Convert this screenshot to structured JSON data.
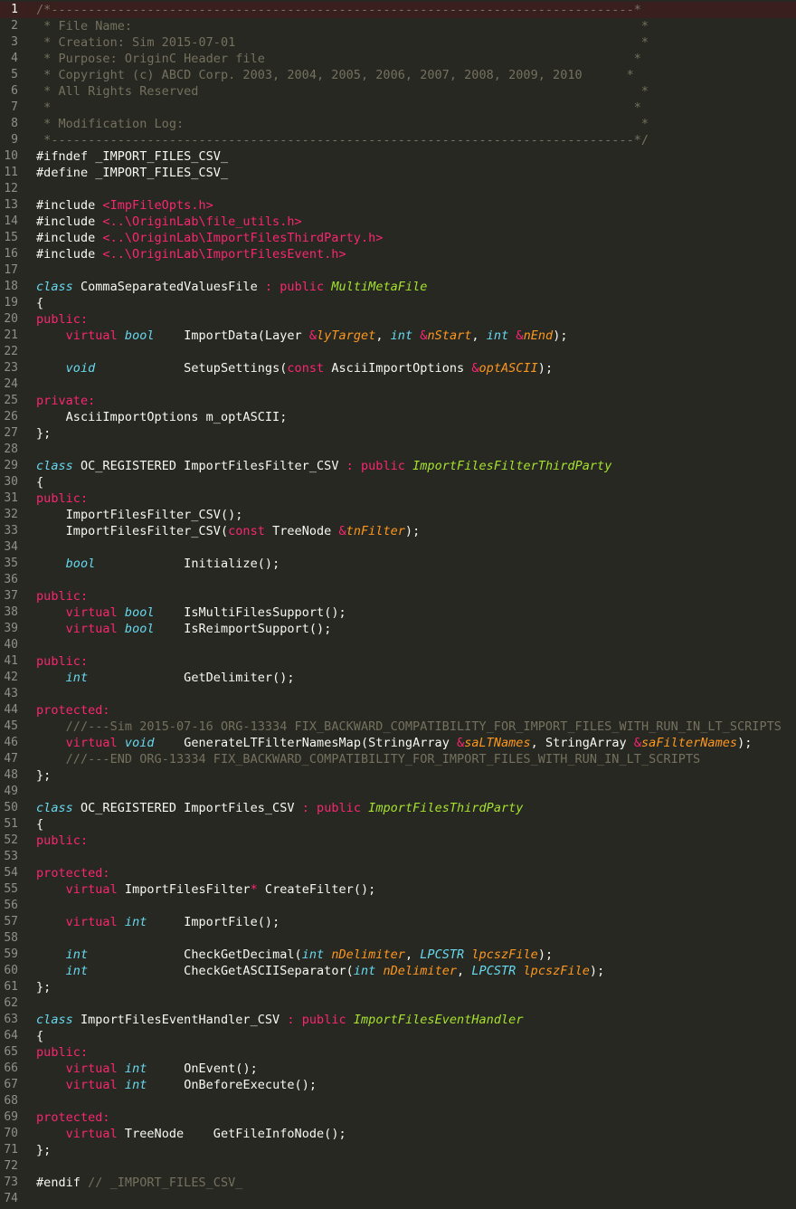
{
  "editor": {
    "theme_colors": {
      "background": "#272822",
      "current_line": "#3a1f1f",
      "comment": "#75715e",
      "keyword": "#f92672",
      "type": "#66d9ef",
      "inherit": "#a6e22e",
      "param": "#fd971f",
      "string": "#e6db74",
      "text": "#f8f8f2",
      "gutter_text": "#8f908a"
    },
    "current_line": 1,
    "lines": [
      {
        "n": "1",
        "tokens": [
          [
            "t-comment",
            "/*-------------------------------------------------------------------------------*"
          ]
        ]
      },
      {
        "n": "2",
        "tokens": [
          [
            "t-comment",
            " * File Name:                                                                     *"
          ]
        ]
      },
      {
        "n": "3",
        "tokens": [
          [
            "t-comment",
            " * Creation: Sim 2015-07-01                                                       *"
          ]
        ]
      },
      {
        "n": "4",
        "tokens": [
          [
            "t-comment",
            " * Purpose: OriginC Header file                                                  *"
          ]
        ]
      },
      {
        "n": "5",
        "tokens": [
          [
            "t-comment",
            " * Copyright (c) ABCD Corp. 2003, 2004, 2005, 2006, 2007, 2008, 2009, 2010      *"
          ]
        ]
      },
      {
        "n": "6",
        "tokens": [
          [
            "t-comment",
            " * All Rights Reserved                                                            *"
          ]
        ]
      },
      {
        "n": "7",
        "tokens": [
          [
            "t-comment",
            " *                                                                               *"
          ]
        ]
      },
      {
        "n": "8",
        "tokens": [
          [
            "t-comment",
            " * Modification Log:                                                              *"
          ]
        ]
      },
      {
        "n": "9",
        "tokens": [
          [
            "t-comment",
            " *-------------------------------------------------------------------------------*/"
          ]
        ]
      },
      {
        "n": "10",
        "tokens": [
          [
            "t-pp",
            "#ifndef _IMPORT_FILES_CSV_"
          ]
        ]
      },
      {
        "n": "11",
        "tokens": [
          [
            "t-pp",
            "#define _IMPORT_FILES_CSV_"
          ]
        ]
      },
      {
        "n": "12",
        "tokens": []
      },
      {
        "n": "13",
        "tokens": [
          [
            "t-pp",
            "#include "
          ],
          [
            "t-kw",
            "<ImpFileOpts.h>"
          ]
        ]
      },
      {
        "n": "14",
        "tokens": [
          [
            "t-pp",
            "#include "
          ],
          [
            "t-kw",
            "<..\\OriginLab\\file_utils.h>"
          ]
        ]
      },
      {
        "n": "15",
        "tokens": [
          [
            "t-pp",
            "#include "
          ],
          [
            "t-kw",
            "<..\\OriginLab\\ImportFilesThirdParty.h>"
          ]
        ]
      },
      {
        "n": "16",
        "tokens": [
          [
            "t-pp",
            "#include "
          ],
          [
            "t-kw",
            "<..\\OriginLab\\ImportFilesEvent.h>"
          ]
        ]
      },
      {
        "n": "17",
        "tokens": []
      },
      {
        "n": "18",
        "tokens": [
          [
            "t-storage",
            "class"
          ],
          [
            "t-text",
            " CommaSeparatedValuesFile "
          ],
          [
            "t-op",
            ":"
          ],
          [
            "t-text",
            " "
          ],
          [
            "t-access",
            "public"
          ],
          [
            "t-text",
            " "
          ],
          [
            "t-inherit",
            "MultiMetaFile"
          ]
        ]
      },
      {
        "n": "19",
        "tokens": [
          [
            "t-text",
            "{"
          ]
        ]
      },
      {
        "n": "20",
        "tokens": [
          [
            "t-access",
            "public"
          ],
          [
            "t-op",
            ":"
          ]
        ]
      },
      {
        "n": "21",
        "tokens": [
          [
            "t-text",
            "    "
          ],
          [
            "t-mod",
            "virtual"
          ],
          [
            "t-text",
            " "
          ],
          [
            "t-type",
            "bool"
          ],
          [
            "t-text",
            "    ImportData(Layer "
          ],
          [
            "t-op",
            "&"
          ],
          [
            "t-param",
            "lyTarget"
          ],
          [
            "t-text",
            ", "
          ],
          [
            "t-type",
            "int"
          ],
          [
            "t-text",
            " "
          ],
          [
            "t-op",
            "&"
          ],
          [
            "t-param",
            "nStart"
          ],
          [
            "t-text",
            ", "
          ],
          [
            "t-type",
            "int"
          ],
          [
            "t-text",
            " "
          ],
          [
            "t-op",
            "&"
          ],
          [
            "t-param",
            "nEnd"
          ],
          [
            "t-text",
            ");"
          ]
        ]
      },
      {
        "n": "22",
        "tokens": []
      },
      {
        "n": "23",
        "tokens": [
          [
            "t-text",
            "    "
          ],
          [
            "t-type",
            "void"
          ],
          [
            "t-text",
            "            SetupSettings("
          ],
          [
            "t-mod",
            "const"
          ],
          [
            "t-text",
            " AsciiImportOptions "
          ],
          [
            "t-op",
            "&"
          ],
          [
            "t-param",
            "optASCII"
          ],
          [
            "t-text",
            ");"
          ]
        ]
      },
      {
        "n": "24",
        "tokens": []
      },
      {
        "n": "25",
        "tokens": [
          [
            "t-access",
            "private"
          ],
          [
            "t-op",
            ":"
          ]
        ]
      },
      {
        "n": "26",
        "tokens": [
          [
            "t-text",
            "    AsciiImportOptions m_optASCII;"
          ]
        ]
      },
      {
        "n": "27",
        "tokens": [
          [
            "t-text",
            "};"
          ]
        ]
      },
      {
        "n": "28",
        "tokens": []
      },
      {
        "n": "29",
        "tokens": [
          [
            "t-storage",
            "class"
          ],
          [
            "t-text",
            " OC_REGISTERED ImportFilesFilter_CSV "
          ],
          [
            "t-op",
            ":"
          ],
          [
            "t-text",
            " "
          ],
          [
            "t-access",
            "public"
          ],
          [
            "t-text",
            " "
          ],
          [
            "t-inherit",
            "ImportFilesFilterThirdParty"
          ]
        ]
      },
      {
        "n": "30",
        "tokens": [
          [
            "t-text",
            "{"
          ]
        ]
      },
      {
        "n": "31",
        "tokens": [
          [
            "t-access",
            "public"
          ],
          [
            "t-op",
            ":"
          ]
        ]
      },
      {
        "n": "32",
        "tokens": [
          [
            "t-text",
            "    ImportFilesFilter_CSV();"
          ]
        ]
      },
      {
        "n": "33",
        "tokens": [
          [
            "t-text",
            "    ImportFilesFilter_CSV("
          ],
          [
            "t-mod",
            "const"
          ],
          [
            "t-text",
            " TreeNode "
          ],
          [
            "t-op",
            "&"
          ],
          [
            "t-param",
            "tnFilter"
          ],
          [
            "t-text",
            ");"
          ]
        ]
      },
      {
        "n": "34",
        "tokens": []
      },
      {
        "n": "35",
        "tokens": [
          [
            "t-text",
            "    "
          ],
          [
            "t-type",
            "bool"
          ],
          [
            "t-text",
            "            Initialize();"
          ]
        ]
      },
      {
        "n": "36",
        "tokens": []
      },
      {
        "n": "37",
        "tokens": [
          [
            "t-access",
            "public"
          ],
          [
            "t-op",
            ":"
          ]
        ]
      },
      {
        "n": "38",
        "tokens": [
          [
            "t-text",
            "    "
          ],
          [
            "t-mod",
            "virtual"
          ],
          [
            "t-text",
            " "
          ],
          [
            "t-type",
            "bool"
          ],
          [
            "t-text",
            "    IsMultiFilesSupport();"
          ]
        ]
      },
      {
        "n": "39",
        "tokens": [
          [
            "t-text",
            "    "
          ],
          [
            "t-mod",
            "virtual"
          ],
          [
            "t-text",
            " "
          ],
          [
            "t-type",
            "bool"
          ],
          [
            "t-text",
            "    IsReimportSupport();"
          ]
        ]
      },
      {
        "n": "40",
        "tokens": []
      },
      {
        "n": "41",
        "tokens": [
          [
            "t-access",
            "public"
          ],
          [
            "t-op",
            ":"
          ]
        ]
      },
      {
        "n": "42",
        "tokens": [
          [
            "t-text",
            "    "
          ],
          [
            "t-type",
            "int"
          ],
          [
            "t-text",
            "             GetDelimiter();"
          ]
        ]
      },
      {
        "n": "43",
        "tokens": []
      },
      {
        "n": "44",
        "tokens": [
          [
            "t-access",
            "protected"
          ],
          [
            "t-op",
            ":"
          ]
        ]
      },
      {
        "n": "45",
        "tokens": [
          [
            "t-text",
            "    "
          ],
          [
            "t-comment",
            "///---Sim 2015-07-16 ORG-13334 FIX_BACKWARD_COMPATIBILITY_FOR_IMPORT_FILES_WITH_RUN_IN_LT_SCRIPTS"
          ]
        ]
      },
      {
        "n": "46",
        "tokens": [
          [
            "t-text",
            "    "
          ],
          [
            "t-mod",
            "virtual"
          ],
          [
            "t-text",
            " "
          ],
          [
            "t-type",
            "void"
          ],
          [
            "t-text",
            "    GenerateLTFilterNamesMap(StringArray "
          ],
          [
            "t-op",
            "&"
          ],
          [
            "t-param",
            "saLTNames"
          ],
          [
            "t-text",
            ", StringArray "
          ],
          [
            "t-op",
            "&"
          ],
          [
            "t-param",
            "saFilterNames"
          ],
          [
            "t-text",
            ");"
          ]
        ]
      },
      {
        "n": "47",
        "tokens": [
          [
            "t-text",
            "    "
          ],
          [
            "t-comment",
            "///---END ORG-13334 FIX_BACKWARD_COMPATIBILITY_FOR_IMPORT_FILES_WITH_RUN_IN_LT_SCRIPTS"
          ]
        ]
      },
      {
        "n": "48",
        "tokens": [
          [
            "t-text",
            "};"
          ]
        ]
      },
      {
        "n": "49",
        "tokens": []
      },
      {
        "n": "50",
        "tokens": [
          [
            "t-storage",
            "class"
          ],
          [
            "t-text",
            " OC_REGISTERED ImportFiles_CSV "
          ],
          [
            "t-op",
            ":"
          ],
          [
            "t-text",
            " "
          ],
          [
            "t-access",
            "public"
          ],
          [
            "t-text",
            " "
          ],
          [
            "t-inherit",
            "ImportFilesThirdParty"
          ]
        ]
      },
      {
        "n": "51",
        "tokens": [
          [
            "t-text",
            "{"
          ]
        ]
      },
      {
        "n": "52",
        "tokens": [
          [
            "t-access",
            "public"
          ],
          [
            "t-op",
            ":"
          ]
        ]
      },
      {
        "n": "53",
        "tokens": []
      },
      {
        "n": "54",
        "tokens": [
          [
            "t-access",
            "protected"
          ],
          [
            "t-op",
            ":"
          ]
        ]
      },
      {
        "n": "55",
        "tokens": [
          [
            "t-text",
            "    "
          ],
          [
            "t-mod",
            "virtual"
          ],
          [
            "t-text",
            " ImportFilesFilter"
          ],
          [
            "t-op",
            "*"
          ],
          [
            "t-text",
            " CreateFilter();"
          ]
        ]
      },
      {
        "n": "56",
        "tokens": []
      },
      {
        "n": "57",
        "tokens": [
          [
            "t-text",
            "    "
          ],
          [
            "t-mod",
            "virtual"
          ],
          [
            "t-text",
            " "
          ],
          [
            "t-type",
            "int"
          ],
          [
            "t-text",
            "     ImportFile();"
          ]
        ]
      },
      {
        "n": "58",
        "tokens": []
      },
      {
        "n": "59",
        "tokens": [
          [
            "t-text",
            "    "
          ],
          [
            "t-type",
            "int"
          ],
          [
            "t-text",
            "             CheckGetDecimal("
          ],
          [
            "t-type",
            "int"
          ],
          [
            "t-text",
            " "
          ],
          [
            "t-param",
            "nDelimiter"
          ],
          [
            "t-text",
            ", "
          ],
          [
            "t-type",
            "LPCSTR"
          ],
          [
            "t-text",
            " "
          ],
          [
            "t-param",
            "lpcszFile"
          ],
          [
            "t-text",
            ");"
          ]
        ]
      },
      {
        "n": "60",
        "tokens": [
          [
            "t-text",
            "    "
          ],
          [
            "t-type",
            "int"
          ],
          [
            "t-text",
            "             CheckGetASCIISeparator("
          ],
          [
            "t-type",
            "int"
          ],
          [
            "t-text",
            " "
          ],
          [
            "t-param",
            "nDelimiter"
          ],
          [
            "t-text",
            ", "
          ],
          [
            "t-type",
            "LPCSTR"
          ],
          [
            "t-text",
            " "
          ],
          [
            "t-param",
            "lpcszFile"
          ],
          [
            "t-text",
            ");"
          ]
        ]
      },
      {
        "n": "61",
        "tokens": [
          [
            "t-text",
            "};"
          ]
        ]
      },
      {
        "n": "62",
        "tokens": []
      },
      {
        "n": "63",
        "tokens": [
          [
            "t-storage",
            "class"
          ],
          [
            "t-text",
            " ImportFilesEventHandler_CSV "
          ],
          [
            "t-op",
            ":"
          ],
          [
            "t-text",
            " "
          ],
          [
            "t-access",
            "public"
          ],
          [
            "t-text",
            " "
          ],
          [
            "t-inherit",
            "ImportFilesEventHandler"
          ]
        ]
      },
      {
        "n": "64",
        "tokens": [
          [
            "t-text",
            "{"
          ]
        ]
      },
      {
        "n": "65",
        "tokens": [
          [
            "t-access",
            "public"
          ],
          [
            "t-op",
            ":"
          ]
        ]
      },
      {
        "n": "66",
        "tokens": [
          [
            "t-text",
            "    "
          ],
          [
            "t-mod",
            "virtual"
          ],
          [
            "t-text",
            " "
          ],
          [
            "t-type",
            "int"
          ],
          [
            "t-text",
            "     OnEvent();"
          ]
        ]
      },
      {
        "n": "67",
        "tokens": [
          [
            "t-text",
            "    "
          ],
          [
            "t-mod",
            "virtual"
          ],
          [
            "t-text",
            " "
          ],
          [
            "t-type",
            "int"
          ],
          [
            "t-text",
            "     OnBeforeExecute();"
          ]
        ]
      },
      {
        "n": "68",
        "tokens": []
      },
      {
        "n": "69",
        "tokens": [
          [
            "t-access",
            "protected"
          ],
          [
            "t-op",
            ":"
          ]
        ]
      },
      {
        "n": "70",
        "tokens": [
          [
            "t-text",
            "    "
          ],
          [
            "t-mod",
            "virtual"
          ],
          [
            "t-text",
            " TreeNode    GetFileInfoNode();"
          ]
        ]
      },
      {
        "n": "71",
        "tokens": [
          [
            "t-text",
            "};"
          ]
        ]
      },
      {
        "n": "72",
        "tokens": []
      },
      {
        "n": "73",
        "tokens": [
          [
            "t-pp",
            "#endif "
          ],
          [
            "t-comment",
            "// _IMPORT_FILES_CSV_"
          ]
        ]
      },
      {
        "n": "74",
        "tokens": []
      }
    ]
  }
}
